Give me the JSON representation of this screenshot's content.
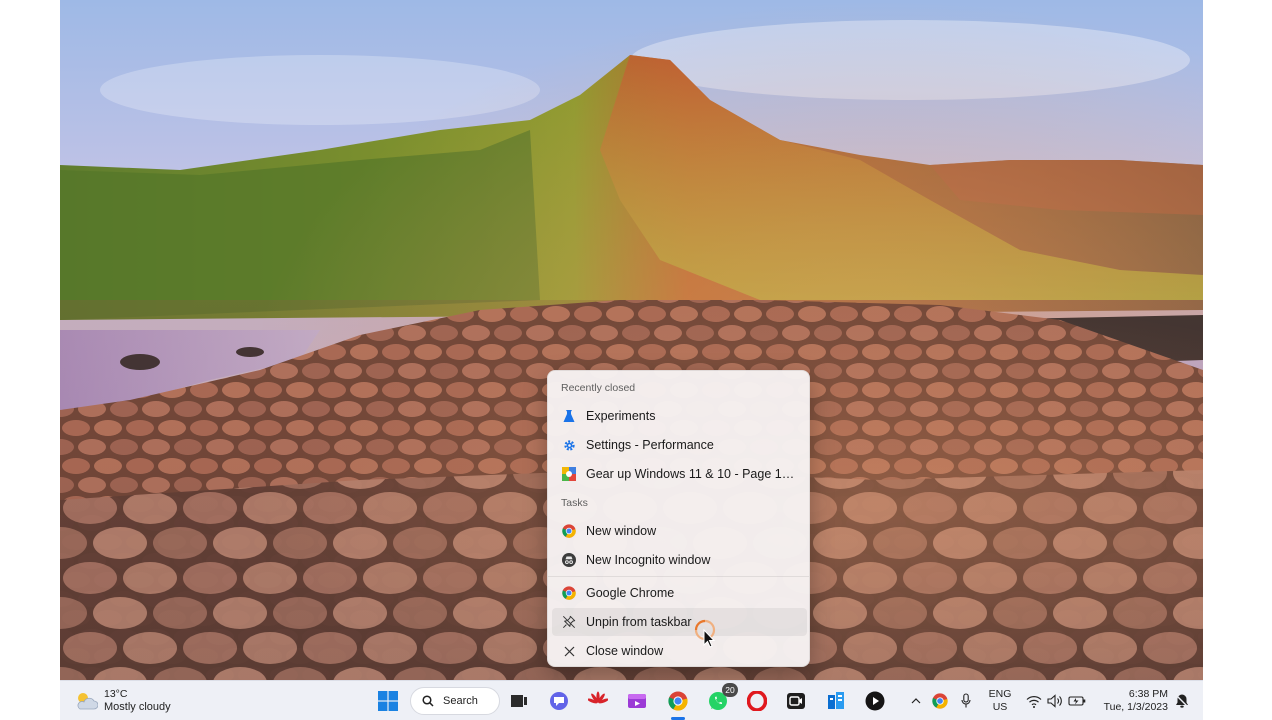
{
  "jumplist": {
    "recently_closed_header": "Recently closed",
    "recently_closed": [
      {
        "label": "Experiments",
        "icon": "flask-icon"
      },
      {
        "label": "Settings - Performance",
        "icon": "settings-gear-icon"
      },
      {
        "label": "Gear up Windows 11 & 10 - Page 14...",
        "icon": "forum-favicon-icon"
      }
    ],
    "tasks_header": "Tasks",
    "tasks": [
      {
        "label": "New window",
        "icon": "chrome-icon"
      },
      {
        "label": "New Incognito window",
        "icon": "incognito-icon"
      }
    ],
    "app_actions": [
      {
        "label": "Google Chrome",
        "icon": "chrome-icon"
      },
      {
        "label": "Unpin from taskbar",
        "icon": "unpin-icon"
      },
      {
        "label": "Close window",
        "icon": "close-icon"
      }
    ]
  },
  "taskbar": {
    "weather": {
      "temperature": "13°C",
      "condition": "Mostly cloudy",
      "icon": "partly-cloudy-icon"
    },
    "search_label": "Search",
    "apps": [
      {
        "name": "start-button",
        "icon": "windows-logo-icon"
      },
      {
        "name": "task-view",
        "icon": "task-view-icon"
      },
      {
        "name": "teams-chat",
        "icon": "chat-icon"
      },
      {
        "name": "huawei-app",
        "icon": "huawei-icon"
      },
      {
        "name": "clipchamp-app",
        "icon": "clipchamp-icon"
      },
      {
        "name": "chrome-app",
        "icon": "chrome-icon"
      },
      {
        "name": "whatsapp-app",
        "icon": "whatsapp-icon",
        "badge": "20"
      },
      {
        "name": "opera-app",
        "icon": "opera-icon"
      },
      {
        "name": "camera-app",
        "icon": "camera-icon"
      },
      {
        "name": "azure-app",
        "icon": "azure-icon"
      },
      {
        "name": "media-player-app",
        "icon": "play-icon"
      }
    ],
    "tray": {
      "language": "ENG",
      "region": "US",
      "time": "6:38 PM",
      "date": "Tue, 1/3/2023"
    }
  },
  "colors": {
    "accent": "#1a73e8",
    "taskbar_bg": "#eef0f6",
    "menu_bg": "#f6f2f2"
  }
}
